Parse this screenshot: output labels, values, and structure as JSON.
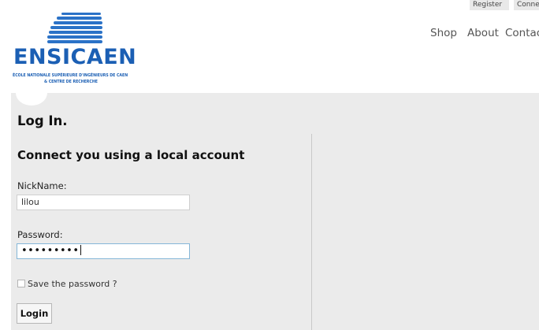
{
  "header": {
    "logo": {
      "name": "ENSICAEN",
      "subtitle_line1": "ÉCOLE NATIONALE SUPÉRIEURE D'INGÉNIEURS DE CAEN",
      "subtitle_line2": "& CENTRE DE RECHERCHE"
    },
    "top_links": [
      "Register",
      "Connect"
    ],
    "nav": [
      "Shop",
      "About",
      "Contact"
    ]
  },
  "main": {
    "title": "Log In.",
    "form_title": "Connect you using a local account",
    "nickname": {
      "label": "NickName:",
      "value": "lilou"
    },
    "password": {
      "label": "Password:",
      "value_mask": "•••••••••"
    },
    "remember_label": "Save the password ?",
    "login_button": "Login"
  },
  "colors": {
    "brand_blue": "#1b5fb4",
    "panel_bg": "#ebebeb",
    "focus_border": "#86b7d8"
  }
}
